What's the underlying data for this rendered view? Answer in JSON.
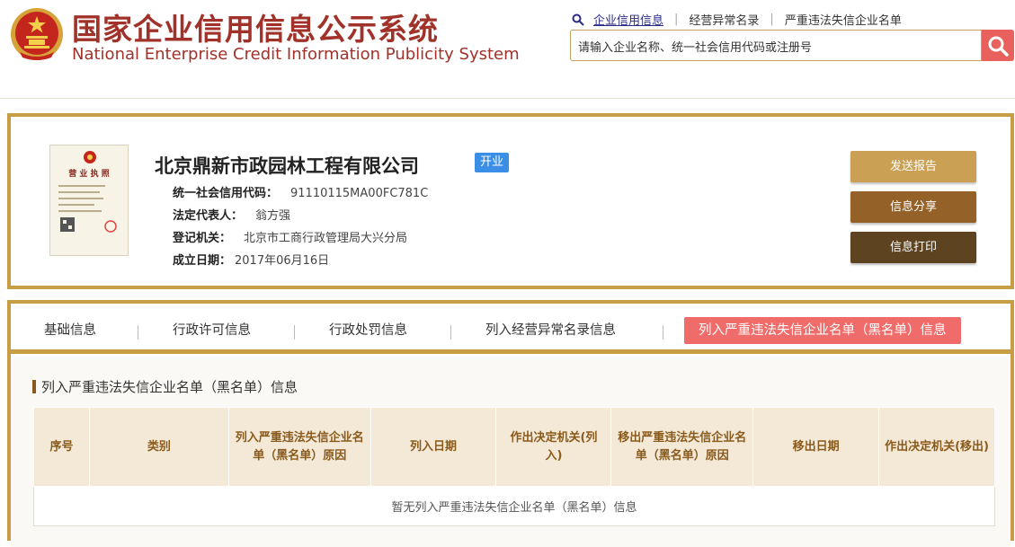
{
  "header": {
    "title_cn": "国家企业信用信息公示系统",
    "title_en": "National Enterprise Credit Information Publicity System",
    "links": [
      "企业信用信息",
      "经营异常名录",
      "严重违法失信企业名单"
    ],
    "search_placeholder": "请输入企业名称、统一社会信用代码或注册号",
    "colors": {
      "brand": "#a0322a",
      "search_button": "#e8615c"
    }
  },
  "company": {
    "license_title": "营 业 执 照",
    "name": "北京鼎新市政园林工程有限公司",
    "status": "开业",
    "fields": [
      {
        "label": "统一社会信用代码：",
        "value": "91110115MA00FC781C"
      },
      {
        "label": "法定代表人：",
        "value": "翁方强"
      },
      {
        "label": "登记机关：",
        "value": "北京市工商行政管理局大兴分局"
      },
      {
        "label": "成立日期：",
        "value": "2017年06月16日"
      }
    ],
    "actions": [
      {
        "label": "发送报告",
        "color": "#c9a054"
      },
      {
        "label": "信息分享",
        "color": "#946128"
      },
      {
        "label": "信息打印",
        "color": "#5e4320"
      }
    ]
  },
  "tabs": [
    {
      "label": "基础信息"
    },
    {
      "label": "行政许可信息"
    },
    {
      "label": "行政处罚信息"
    },
    {
      "label": "列入经营异常名录信息"
    },
    {
      "label": "列入严重违法失信企业名单（黑名单）信息"
    }
  ],
  "section": {
    "title": "列入严重违法失信企业名单（黑名单）信息",
    "columns": [
      "序号",
      "类别",
      "列入严重违法失信企业名单（黑名单）原因",
      "列入日期",
      "作出决定机关(列入)",
      "移出严重违法失信企业名单（黑名单）原因",
      "移出日期",
      "作出决定机关(移出)"
    ],
    "empty_message": "暂无列入严重违法失信企业名单（黑名单）信息"
  }
}
